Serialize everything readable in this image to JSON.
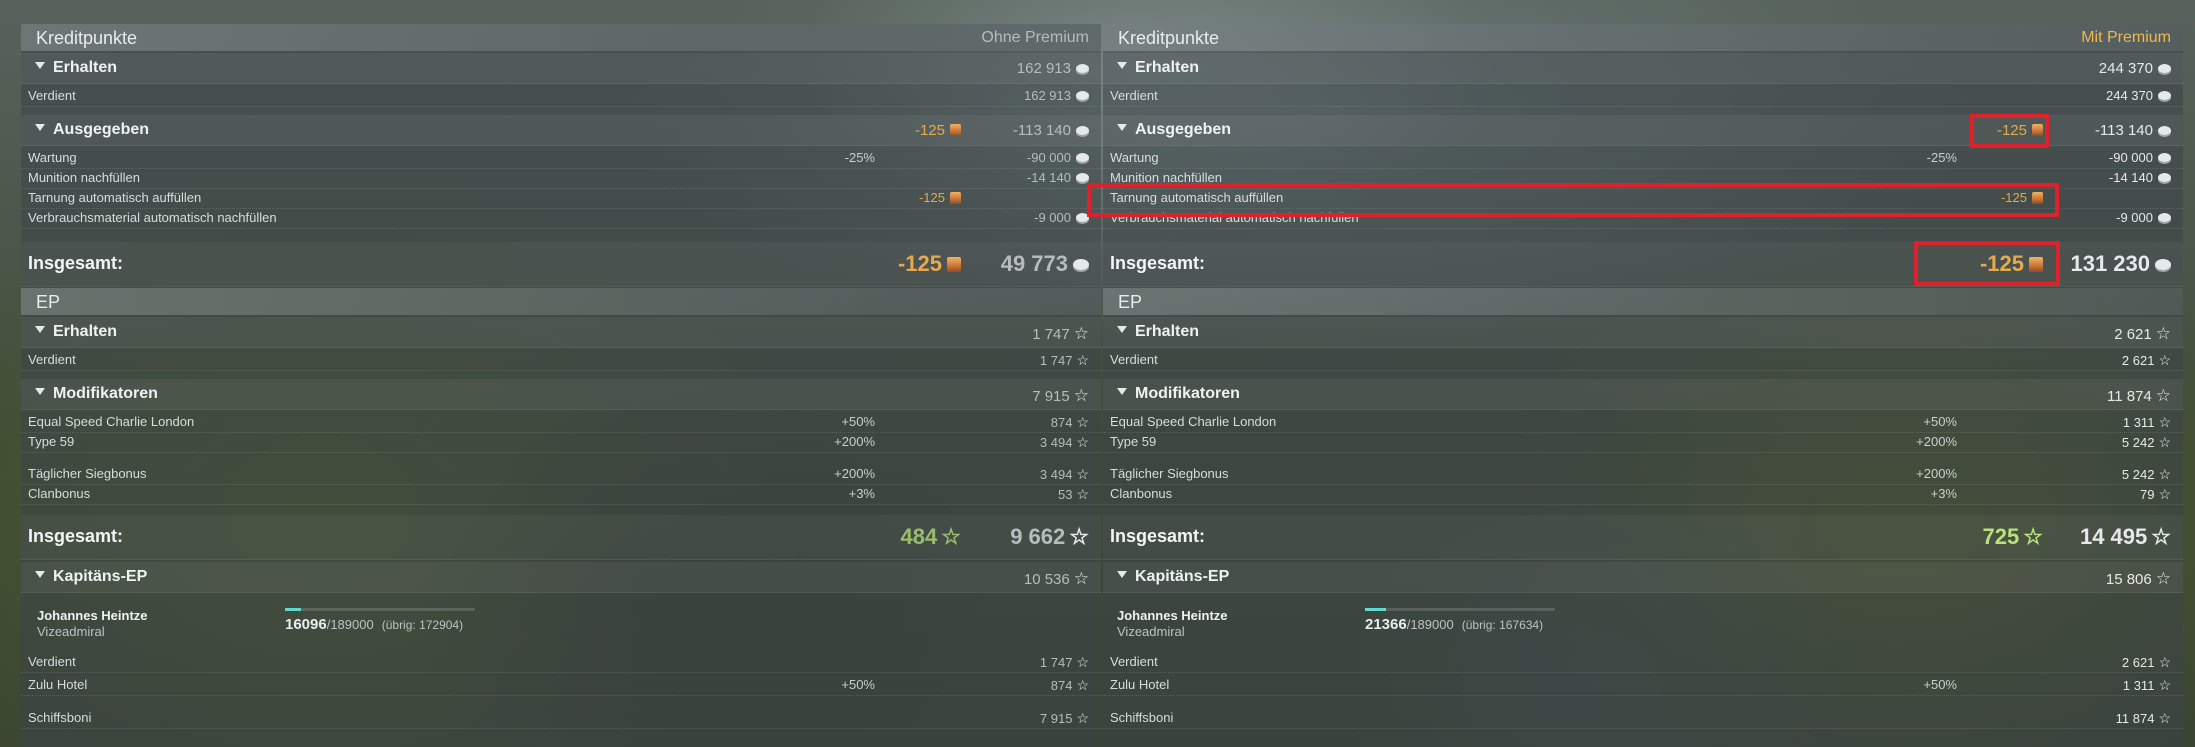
{
  "left": {
    "credits_title": "Kreditpunkte",
    "mode": "Ohne Premium",
    "earned_label": "Erhalten",
    "earned_value": "162 913",
    "verdient_label": "Verdient",
    "verdient_value": "162 913",
    "spent_label": "Ausgegeben",
    "spent_premium": "-125",
    "spent_value": "-113 140",
    "wartung_label": "Wartung",
    "wartung_pct": "-25%",
    "wartung_value": "-90 000",
    "munition_label": "Munition nachfüllen",
    "munition_value": "-14 140",
    "tarnung_label": "Tarnung automatisch auffüllen",
    "tarnung_value": "-125",
    "verbrauch_label": "Verbrauchsmaterial automatisch nachfüllen",
    "verbrauch_value": "-9 000",
    "total_label": "Insgesamt:",
    "total_premium": "-125",
    "total_value": "49 773",
    "ep_title": "EP",
    "ep_earned_label": "Erhalten",
    "ep_earned_value": "1 747",
    "ep_verdient_label": "Verdient",
    "ep_verdient_value": "1 747",
    "mod_label": "Modifikatoren",
    "mod_value": "7 915",
    "mod_items": [
      {
        "label": "Equal Speed Charlie London",
        "pct": "+50%",
        "value": "874"
      },
      {
        "label": "Type 59",
        "pct": "+200%",
        "value": "3 494"
      },
      {
        "label": "Täglicher Siegbonus",
        "pct": "+200%",
        "value": "3 494"
      },
      {
        "label": "Clanbonus",
        "pct": "+3%",
        "value": "53"
      }
    ],
    "ep_total_label": "Insgesamt:",
    "ep_total_free": "484",
    "ep_total_value": "9 662",
    "cap_label": "Kapitäns-EP",
    "cap_value": "10 536",
    "captain_name": "Johannes Heintze",
    "captain_rank": "Vizeadmiral",
    "xp_current": "16096",
    "xp_max": "/189000",
    "xp_remaining": "(übrig: 172904)",
    "xp_progress": 0.085,
    "cap_verdient_label": "Verdient",
    "cap_verdient_value": "1 747",
    "zulu_label": "Zulu Hotel",
    "zulu_pct": "+50%",
    "zulu_value": "874",
    "schiffsboni_label": "Schiffsboni",
    "schiffsboni_value": "7 915"
  },
  "right": {
    "credits_title": "Kreditpunkte",
    "mode": "Mit Premium",
    "earned_label": "Erhalten",
    "earned_value": "244 370",
    "verdient_label": "Verdient",
    "verdient_value": "244 370",
    "spent_label": "Ausgegeben",
    "spent_premium": "-125",
    "spent_value": "-113 140",
    "wartung_label": "Wartung",
    "wartung_pct": "-25%",
    "wartung_value": "-90 000",
    "munition_label": "Munition nachfüllen",
    "munition_value": "-14 140",
    "tarnung_label": "Tarnung automatisch auffüllen",
    "tarnung_value": "-125",
    "verbrauch_label": "Verbrauchsmaterial automatisch nachfüllen",
    "verbrauch_value": "-9 000",
    "total_label": "Insgesamt:",
    "total_premium": "-125",
    "total_value": "131 230",
    "ep_title": "EP",
    "ep_earned_label": "Erhalten",
    "ep_earned_value": "2 621",
    "ep_verdient_label": "Verdient",
    "ep_verdient_value": "2 621",
    "mod_label": "Modifikatoren",
    "mod_value": "11 874",
    "mod_items": [
      {
        "label": "Equal Speed Charlie London",
        "pct": "+50%",
        "value": "1 311"
      },
      {
        "label": "Type 59",
        "pct": "+200%",
        "value": "5 242"
      },
      {
        "label": "Täglicher Siegbonus",
        "pct": "+200%",
        "value": "5 242"
      },
      {
        "label": "Clanbonus",
        "pct": "+3%",
        "value": "79"
      }
    ],
    "ep_total_label": "Insgesamt:",
    "ep_total_free": "725",
    "ep_total_value": "14 495",
    "cap_label": "Kapitäns-EP",
    "cap_value": "15 806",
    "captain_name": "Johannes Heintze",
    "captain_rank": "Vizeadmiral",
    "xp_current": "21366",
    "xp_max": "/189000",
    "xp_remaining": "(übrig: 167634)",
    "xp_progress": 0.113,
    "cap_verdient_label": "Verdient",
    "cap_verdient_value": "2 621",
    "zulu_label": "Zulu Hotel",
    "zulu_pct": "+50%",
    "zulu_value": "1 311",
    "schiffsboni_label": "Schiffsboni",
    "schiffsboni_value": "11 874"
  },
  "icons": {
    "credit": "credit-coin-icon",
    "premium": "premium-camo-icon",
    "xp": "star-icon"
  }
}
